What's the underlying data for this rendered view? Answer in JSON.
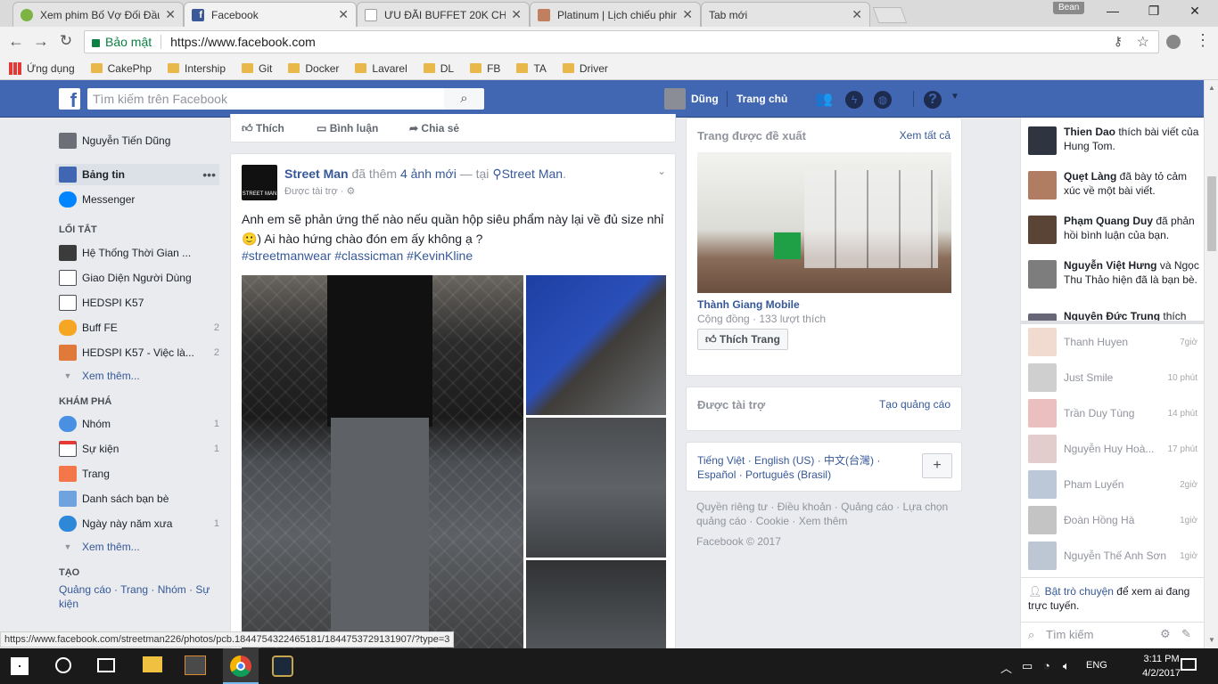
{
  "browser": {
    "tabs": [
      {
        "title": "Xem phim Bố Vợ Đối Đầu",
        "favicon_color": "#7cb342"
      },
      {
        "title": "Facebook",
        "favicon_color": "#3b5998"
      },
      {
        "title": "ƯU ĐÃI BUFFET 20K CHO",
        "favicon_color": "#9e9e9e"
      },
      {
        "title": "Platinum | Lịch chiếu phim",
        "favicon_color": "#c08060"
      },
      {
        "title": "Tab mới",
        "favicon_color": ""
      }
    ],
    "profile_name": "Bean",
    "security_label": "Bảo mật",
    "url": "https://www.facebook.com",
    "bookmarks": [
      {
        "label": "Ứng dụng",
        "icon": "apps-icon"
      },
      {
        "label": "CakePhp",
        "icon": "folder-icon"
      },
      {
        "label": "Intership",
        "icon": "folder-icon"
      },
      {
        "label": "Git",
        "icon": "folder-icon"
      },
      {
        "label": "Docker",
        "icon": "folder-icon"
      },
      {
        "label": "Lavarel",
        "icon": "folder-icon"
      },
      {
        "label": "DL",
        "icon": "folder-icon"
      },
      {
        "label": "FB",
        "icon": "folder-icon"
      },
      {
        "label": "TA",
        "icon": "folder-icon"
      },
      {
        "label": "Driver",
        "icon": "folder-icon"
      }
    ],
    "status_url": "https://www.facebook.com/streetman226/photos/pcb.1844754322465181/1844753729131907/?type=3"
  },
  "header": {
    "logo": "f",
    "search_placeholder": "Tìm kiếm trên Facebook",
    "user_name": "Dũng",
    "home_label": "Trang chủ",
    "brand_color": "#4267b2"
  },
  "left_nav": {
    "profile": "Nguyễn Tiến Dũng",
    "news_feed": "Bảng tin",
    "messenger": "Messenger",
    "shortcuts_heading": "LỐI TẮT",
    "shortcuts": [
      {
        "label": "Hệ Thống Thời Gian ...",
        "count": ""
      },
      {
        "label": "Giao Diện Người Dùng",
        "count": ""
      },
      {
        "label": "HEDSPI K57",
        "count": ""
      },
      {
        "label": "Buff FE",
        "count": "2"
      },
      {
        "label": "HEDSPI K57 - Việc là...",
        "count": "2"
      }
    ],
    "see_more": "Xem thêm...",
    "explore_heading": "KHÁM PHÁ",
    "explore": [
      {
        "label": "Nhóm",
        "count": "1"
      },
      {
        "label": "Sự kiện",
        "count": "1"
      },
      {
        "label": "Trang",
        "count": ""
      },
      {
        "label": "Danh sách bạn bè",
        "count": ""
      },
      {
        "label": "Ngày này năm xưa",
        "count": "1"
      }
    ],
    "create_heading": "TẠO",
    "create_links": "Quảng cáo · Trang · Nhóm · Sự kiện"
  },
  "feed": {
    "actions": {
      "like": "Thích",
      "comment": "Bình luận",
      "share": "Chia sẻ"
    },
    "post": {
      "author": "Street Man",
      "action_text": " đã thêm ",
      "photos_link": "4 ảnh mới",
      "at_text": " — tại ",
      "place": "Street Man",
      "end": ".",
      "sponsored": "Được tài trợ · ",
      "text": "Anh em sẽ phản ứng thế nào nếu quần hộp siêu phẩm này lại về đủ size nhỉ 🙂) Ai hào hứng chào đón em ấy không ạ ?",
      "hashtags": "#streetmanwear #classicman #KevinKline",
      "logo_text": "STREET MAN"
    }
  },
  "right_col": {
    "suggested_title": "Trang được đề xuất",
    "see_all": "Xem tất cả",
    "page_name": "Thành Giang Mobile",
    "page_meta": "Cộng đồng · 133 lượt thích",
    "like_page": "Thích Trang",
    "sponsored_title": "Được tài trợ",
    "create_ad": "Tạo quảng cáo",
    "languages": "Tiếng Việt · English (US) · 中文(台灣) · Español · Português (Brasil)",
    "footer_links": "Quyền riêng tư · Điều khoản · Quảng cáo · Lựa chọn quảng cáo · Cookie · Xem thêm",
    "copyright": "Facebook © 2017"
  },
  "chat": {
    "ticker": [
      {
        "name": "Thien Dao",
        "text": " thích bài viết của Hung Tom."
      },
      {
        "name": "Quẹt Làng",
        "text": " đã bày tỏ cảm xúc về một bài viết."
      },
      {
        "name": "Phạm Quang Duy",
        "text": " đã phản hồi bình luận của bạn."
      },
      {
        "name": "Nguyễn Việt Hưng",
        "text": " và Ngọc Thu Thảo hiện đã là bạn bè."
      },
      {
        "name": "Nguyễn Đức Trung",
        "text": " thích"
      }
    ],
    "contacts": [
      {
        "name": "Thanh Huyen",
        "time": "7giờ"
      },
      {
        "name": "Just Smile",
        "time": "10 phút"
      },
      {
        "name": "Trần Duy Tùng",
        "time": "14 phút"
      },
      {
        "name": "Nguyễn Huy Hoà...",
        "time": "17 phút"
      },
      {
        "name": "Pham Luyến",
        "time": "2giờ"
      },
      {
        "name": "Đoàn Hồng Hà",
        "time": "1giờ"
      },
      {
        "name": "Nguyễn Thế Anh Sơn",
        "time": "1giờ"
      }
    ],
    "enable_chat_link": "Bật trò chuyện",
    "enable_chat_text": " để xem ai đang trực tuyến.",
    "search_placeholder": "Tìm kiếm"
  },
  "taskbar": {
    "time": "3:11 PM",
    "date": "4/2/2017",
    "lang": "ENG"
  }
}
